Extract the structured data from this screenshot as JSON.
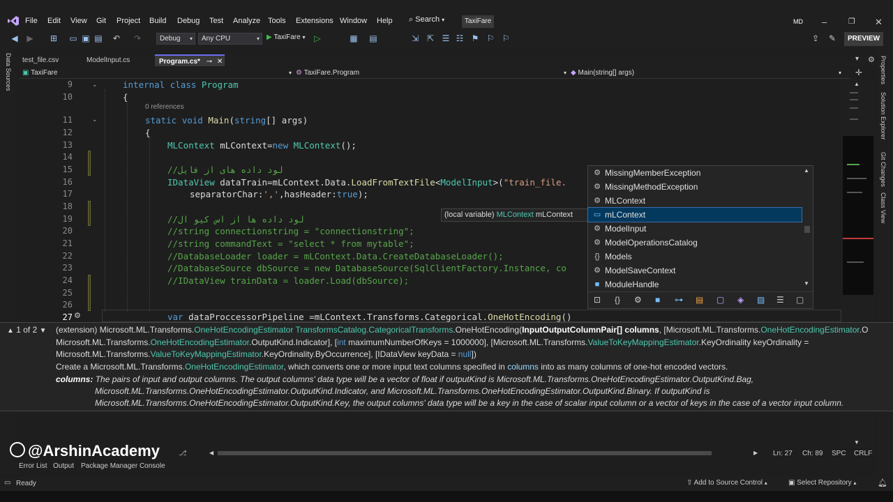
{
  "menu": [
    "File",
    "Edit",
    "View",
    "Git",
    "Project",
    "Build",
    "Debug",
    "Test",
    "Analyze",
    "Tools",
    "Extensions",
    "Window",
    "Help"
  ],
  "search_label": "Search",
  "solution_name": "TaxiFare",
  "user_initials": "MD",
  "toolbar": {
    "config": "Debug",
    "platform": "Any CPU",
    "start_target": "TaxiFare",
    "preview_label": "PREVIEW"
  },
  "left_strip_label": "Data Sources",
  "right_strip_labels": [
    "Properties",
    "Solution Explorer",
    "Git Changes",
    "Class View"
  ],
  "tabs": [
    {
      "label": "test_file.csv"
    },
    {
      "label": "ModelInput.cs"
    },
    {
      "label": "Program.cs*"
    }
  ],
  "navbar": {
    "project": "TaxiFare",
    "type": "TaxiFare.Program",
    "member": "Main(string[] args)"
  },
  "code": {
    "line_numbers": [
      "9",
      "10",
      "11",
      "12",
      "13",
      "14",
      "15",
      "16",
      "17",
      "18",
      "19",
      "20",
      "21",
      "22",
      "23",
      "24",
      "25",
      "26",
      "27"
    ],
    "references_label": "0 references",
    "lines": {
      "l9a": "internal",
      "l9b": "class",
      "l9c": "Program",
      "l10": "{",
      "l11a": "static",
      "l11b": "void",
      "l11c": "Main",
      "l11d": "(",
      "l11e": "string",
      "l11f": "[] args)",
      "l12": "{",
      "l13a": "MLContext",
      "l13b": " mLContext=",
      "l13c": "new",
      "l13d": "MLContext",
      "l13e": "();",
      "l15": "//لود داده های از فایل",
      "l16a": "IDataView",
      "l16b": " dataTrain=mLContext.Data.",
      "l16c": "LoadFromTextFile",
      "l16d": "<",
      "l16e": "ModelInput",
      "l16f": ">(",
      "l16g": "\"train_file.",
      "l17a": "separatorChar:",
      "l17b": "','",
      "l17c": ",hasHeader:",
      "l17d": "true",
      "l17e": ");",
      "l19": "//لود داده ها از اس کیو ال",
      "l20": "//string connectionstring = \"connectionstring\";",
      "l21": "//string commandText = \"select * from mytable\";",
      "l22": "//DatabaseLoader loader = mLContext.Data.CreateDatabaseLoader();",
      "l23": "//DatabaseSource dbSource = new DatabaseSource(SqlClientFactory.Instance, co",
      "l24": "//IDataView trainData = loader.Load(dbSource);",
      "l27a": "var",
      "l27b": " dataProccessorPipeline =mLContext.Transforms.Categorical.",
      "l27c": "OneHotEncoding",
      "l27d": "()"
    }
  },
  "quickinfo": {
    "prefix": "(local variable)",
    "type": "MLContext",
    "name": "mLContext"
  },
  "completion": {
    "items": [
      {
        "label": "MissingMemberException",
        "icon": "class-icon"
      },
      {
        "label": "MissingMethodException",
        "icon": "class-icon"
      },
      {
        "label": "MLContext",
        "icon": "class-icon"
      },
      {
        "label": "mLContext",
        "icon": "local-variable-icon"
      },
      {
        "label": "ModelInput",
        "icon": "class-icon"
      },
      {
        "label": "ModelOperationsCatalog",
        "icon": "class-icon"
      },
      {
        "label": "Models",
        "icon": "namespace-icon"
      },
      {
        "label": "ModelSaveContext",
        "icon": "class-icon"
      },
      {
        "label": "ModuleHandle",
        "icon": "struct-icon"
      }
    ]
  },
  "sighelp": {
    "counter": "1 of 2",
    "l1a": "(extension) Microsoft.ML.Transforms.",
    "l1b": "OneHotEncodingEstimator",
    "l1c": " TransformsCatalog.",
    "l1d": "CategoricalTransforms",
    "l1e": ".OneHotEncoding(",
    "l1f": "InputOutputColumnPair",
    "l1g": "[] columns",
    "l1h": ", [Microsoft.ML.Transforms.",
    "l1i": "OneHotEncodingEstimator",
    "l1j": ".O",
    "l2a": "Microsoft.ML.Transforms.",
    "l2b": "OneHotEncodingEstimator",
    "l2c": ".OutputKind.Indicator], [",
    "l2d": "int",
    "l2e": " maximumNumberOfKeys = 1000000], [Microsoft.ML.Transforms.",
    "l2f": "ValueToKeyMappingEstimator",
    "l2g": ".KeyOrdinality keyOrdinality =",
    "l3a": "Microsoft.ML.Transforms.",
    "l3b": "ValueToKeyMappingEstimator",
    "l3c": ".KeyOrdinality.ByOccurrence], [IDataView keyData = ",
    "l3d": "null",
    "l3e": "])",
    "l4a": "Create a Microsoft.ML.Transforms.",
    "l4b": "OneHotEncodingEstimator",
    "l4c": ", which converts one or more input text columns specified in ",
    "l4d": "columns",
    "l4e": " into as many columns of one-hot encoded vectors.",
    "p_name": "columns:",
    "p1": "The pairs of input and output columns. The output columns' data type will be a vector of float if outputKind is Microsoft.ML.Transforms.OneHotEncodingEstimator.OutputKind.Bag,",
    "p2": "Microsoft.ML.Transforms.OneHotEncodingEstimator.OutputKind.Indicator, and Microsoft.ML.Transforms.OneHotEncodingEstimator.OutputKind.Binary. If outputKind is",
    "p3": "Microsoft.ML.Transforms.OneHotEncodingEstimator.OutputKind.Key, the output columns' data type will be a key in the case of scalar input column or a vector of keys in the case of a vector input column."
  },
  "watermark": "@ArshinAcademy",
  "editor_status": {
    "line": "Ln: 27",
    "col": "Ch: 89",
    "indent": "SPC",
    "eol": "CRLF"
  },
  "tool_tabs": [
    "Error List",
    "Output",
    "Package Manager Console"
  ],
  "status": {
    "ready": "Ready",
    "add_source": "Add to Source Control",
    "select_repo": "Select Repository"
  },
  "colors": {
    "accent": "#6c6cf0",
    "keyword": "#569cd6",
    "type": "#4ec9b0",
    "comment": "#57a64a",
    "string": "#d69d85"
  }
}
